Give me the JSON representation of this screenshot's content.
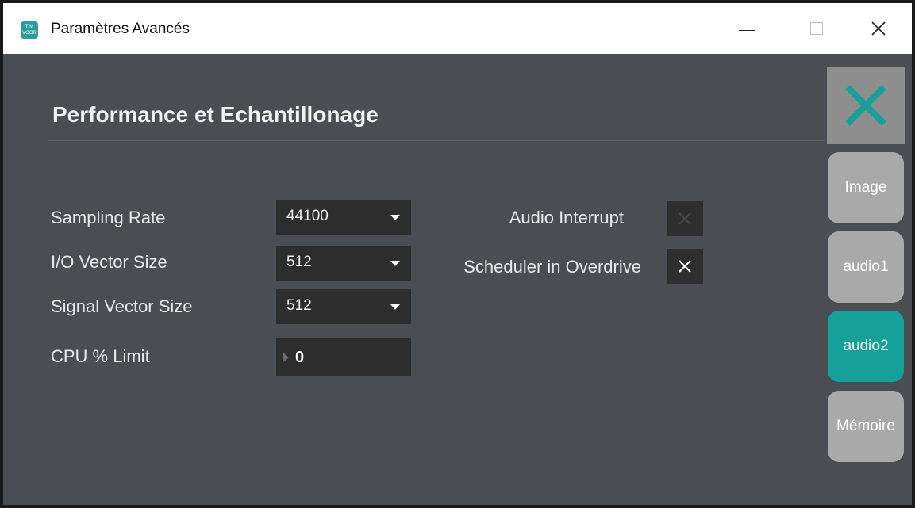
{
  "window": {
    "title": "Paramètres Avancés",
    "app_icon_text": "TIM VOOR"
  },
  "panel": {
    "title": "Performance et Echantillonage"
  },
  "settings": {
    "sampling_rate": {
      "label": "Sampling Rate",
      "value": "44100"
    },
    "io_vector_size": {
      "label": "I/O Vector Size",
      "value": "512"
    },
    "signal_vector_size": {
      "label": "Signal Vector Size",
      "value": "512"
    },
    "cpu_limit": {
      "label": "CPU % Limit",
      "value": "0"
    }
  },
  "toggles": {
    "audio_interrupt": {
      "label": "Audio Interrupt",
      "checked": false
    },
    "scheduler_overdrive": {
      "label": "Scheduler in Overdrive",
      "checked": true
    }
  },
  "side_tabs": [
    {
      "label": "Image",
      "active": false
    },
    {
      "label": "audio1",
      "active": false
    },
    {
      "label": "audio2",
      "active": true
    },
    {
      "label": "Mémoire",
      "active": false
    }
  ],
  "colors": {
    "accent": "#16a09a",
    "panel_bg": "#4a4d52",
    "control_bg": "#2d2d2e",
    "tab_inactive": "#a9a9a9",
    "close_bg": "#8e8e8e"
  },
  "icons": {
    "app": "app-logo-icon",
    "minimize": "minimize-icon",
    "maximize": "maximize-icon",
    "close": "close-icon",
    "panel_close": "close-x-icon",
    "dropdown": "caret-down-icon",
    "number": "triangle-right-icon",
    "toggle": "x-mark-icon"
  }
}
